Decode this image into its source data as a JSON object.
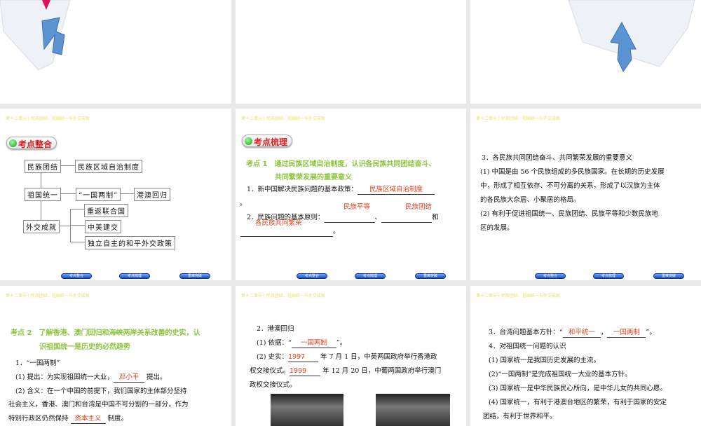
{
  "header": "第十二单元 | 民族团结、祖国统一与外交成就",
  "nav": [
    "考点整合",
    "考点梳理",
    "重难突破"
  ],
  "slide_a": {
    "badge": "考点整合",
    "diagram": {
      "n1": "民族团结",
      "n2": "民族区域自治制度",
      "n3": "祖国统一",
      "n4": "“一国两制”",
      "n5": "港澳回归",
      "n6": "外交成就",
      "n7": "重返联合国",
      "n8": "中美建交",
      "n9": "独立自主的和平外交政策"
    }
  },
  "slide_b": {
    "badge": "考点梳理",
    "title1": "考点 1　通过民族区域自治制度，认识各民族共同团结奋斗、",
    "title2": "共同繁荣发展的重要意义",
    "l1": "1．新中国解决民族问题的基本政策：",
    "a1": "民族区域自治制度",
    "dot": "。",
    "l2": "2．民族问题的基本原则：",
    "a2": "民族平等",
    "sep": "、",
    "a3": "民族团结",
    "and": "和",
    "a4": "各民族共同繁荣",
    "end": "。"
  },
  "slide_c": {
    "l1": "3．各民族共同团结奋斗、共同繁荣发展的重要意义",
    "l2": "(1) 中国是由 56 个民族组成的多民族国家。在长期的历史发展",
    "l3": "中，形成了相互依存、不可分离的关系，形成了以汉族为主体",
    "l4": "的各民族大杂居、小聚居的格局。",
    "l5": "(2) 有利于促进祖国统一、民族团结、民族平等和少数民族地",
    "l6": "区的发展。"
  },
  "slide_d": {
    "title1": "考点 2　了解香港、澳门回归和海峡两岸关系改善的史实，认",
    "title2": "识祖国统一是历史的必然趋势",
    "l1": "1．“一国两制”",
    "l2a": "(1) 提出：为实现祖国统一大业，",
    "a1": "邓小平",
    "l2b": "提出。",
    "l3": "(2) 含义：在一个中国的前提下，我们国家的主体部分坚持",
    "l4": "社会主义，香港、澳门和台湾是中国不可分割的一部分，作为",
    "l5a": "特别行政区仍然保持",
    "a2": "资本主义",
    "l5b": "制度。"
  },
  "slide_e": {
    "l1": "2．港澳回归",
    "l2a": "(1) 依据：“",
    "a1": "一国两制",
    "l2b": "”。",
    "l3a": "(2) 史实：",
    "a2": "1997",
    "l3b": "年 7 月 1 日，中英两国政府举行香港政",
    "l4a": "权交接仪式。",
    "a3": "1999",
    "l4b": "年 12 月 20 日，中葡两国政府举行澳门",
    "l5": "政权交接仪式。"
  },
  "slide_f": {
    "l1a": "3．台湾问题基本方针：“",
    "a1": "和平统一",
    "comma": "，",
    "a2": "一国两制",
    "l1b": "”。",
    "l2": "4．对祖国统一问题的认识",
    "l3": "(1) 国家统一是我国历史发展的主流。",
    "l4": "(2)“一国两制”是完成祖国统一大业的基本方针。",
    "l5": "(3) 国家统一是中华民族民心所向，是中华儿女的共同心愿。",
    "l6": "(4) 国家统一，有利于港澳台地区的繁荣，有利于国家的安定",
    "l7": "团结，有利于世界和平。"
  }
}
